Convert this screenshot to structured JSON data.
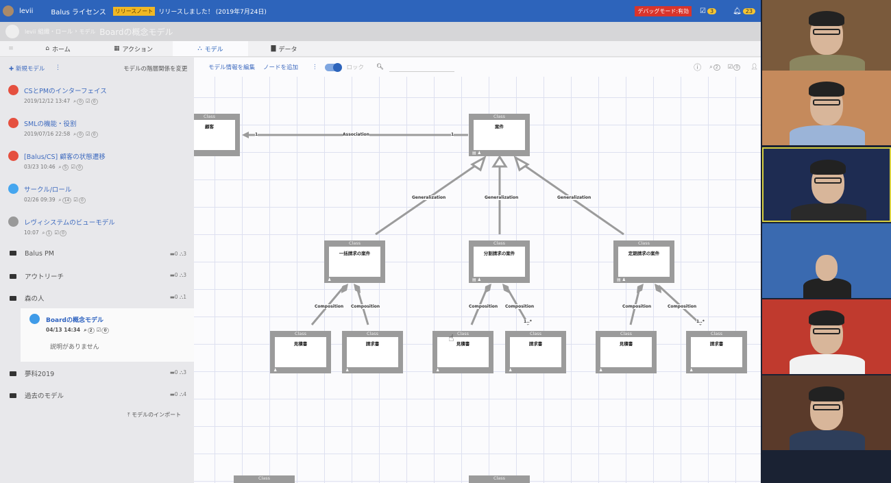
{
  "topbar": {
    "user": "levii",
    "license": "Balus ライセンス",
    "release_tag": "リリースノート",
    "release_text": "リリースしました！ (2019年7月24日)",
    "debug": "デバッグモード:有効",
    "tasks_count": "3",
    "notif_count": "23"
  },
  "breadcrumb": {
    "org": "levii",
    "project": "組織・ロール",
    "section": "モデル",
    "title": "Boardの概念モデル"
  },
  "tabs": [
    {
      "label": "ホーム"
    },
    {
      "label": "アクション"
    },
    {
      "label": "モデル"
    },
    {
      "label": "データ"
    }
  ],
  "sidebar": {
    "new_model": "新規モデル",
    "change_hierarchy": "モデルの階層関係を変更",
    "models": [
      {
        "title": "CSとPMのインターフェイス",
        "date": "2019/12/12 13:47",
        "comments": "0",
        "tasks": "0",
        "color": "#e5503f"
      },
      {
        "title": "SMLの機能・役割",
        "date": "2019/07/16 22:58",
        "comments": "0",
        "tasks": "0",
        "color": "#e5503f"
      },
      {
        "title": "[Balus/CS] 顧客の状態遷移",
        "date": "03/23 10:46",
        "comments": "5",
        "tasks": "0",
        "color": "#e5503f"
      },
      {
        "title": "サークル/ロール",
        "date": "02/26 09:39",
        "comments": "14",
        "tasks": "0",
        "color": "#45a6ef"
      },
      {
        "title": "レヴィシステムのビューモデル",
        "date": "10:07",
        "comments": "1",
        "tasks": "0",
        "color": "#999999"
      }
    ],
    "folders": [
      {
        "name": "Balus PM",
        "folders": "0",
        "models": "3"
      },
      {
        "name": "アウトリーチ",
        "folders": "0",
        "models": "3"
      },
      {
        "name": "森の人",
        "folders": "0",
        "models": "1"
      },
      {
        "name": "夢科2019",
        "folders": "0",
        "models": "3"
      },
      {
        "name": "過去のモデル",
        "folders": "0",
        "models": "4"
      }
    ],
    "selected": {
      "title": "Boardの概念モデル",
      "date": "04/13 14:34",
      "comments": "2",
      "tasks": "0",
      "description": "説明がありません"
    },
    "import": "モデルのインポート"
  },
  "toolbar": {
    "edit_info": "モデル情報を編集",
    "add_node": "ノードを追加",
    "lock": "ロック",
    "comments": "2",
    "tasks": "0"
  },
  "diagram": {
    "stereotype": "Class",
    "classes": {
      "customer": "顧客",
      "case": "案件",
      "lump": "一括請求の案件",
      "split": "分割請求の案件",
      "periodic": "定期請求の案件",
      "estimate": "見積書",
      "invoice": "請求書"
    },
    "edges": {
      "association": "Association",
      "generalization": "Generalization",
      "composition": "Composition",
      "one": "1",
      "many": "1..*"
    }
  }
}
